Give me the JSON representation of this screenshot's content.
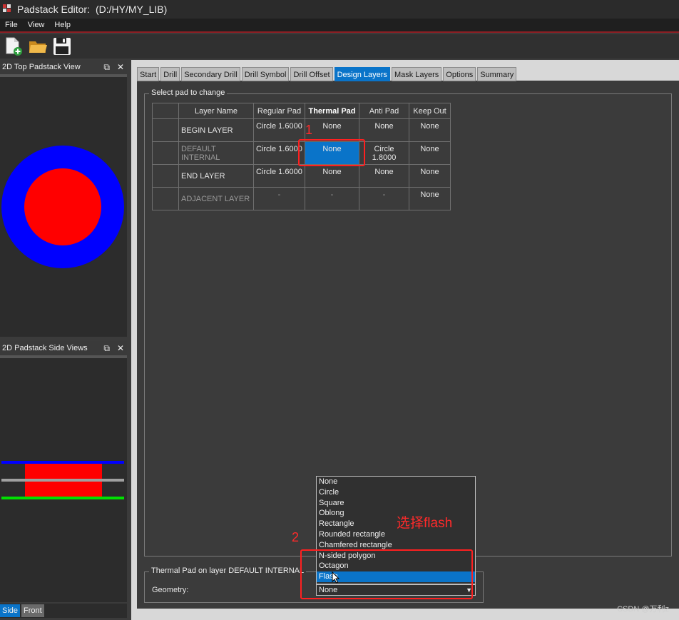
{
  "window": {
    "title": "Padstack Editor:",
    "path": "(D:/HY/MY_LIB)"
  },
  "menu": [
    "File",
    "View",
    "Help"
  ],
  "toolbar": {
    "icons": [
      "new-file-icon",
      "open-folder-icon",
      "save-icon"
    ]
  },
  "top_view": {
    "title": "2D Top Padstack View",
    "colors": {
      "outer": "#0000ff",
      "inner": "#ff0000"
    }
  },
  "side_view": {
    "title": "2D Padstack Side Views"
  },
  "bottom_tabs": [
    "Side",
    "Front"
  ],
  "tabs": [
    "Start",
    "Drill",
    "Secondary Drill",
    "Drill Symbol",
    "Drill Offset",
    "Design Layers",
    "Mask Layers",
    "Options",
    "Summary"
  ],
  "active_tab": "Design Layers",
  "pad_group": {
    "title": "Select pad to change"
  },
  "table": {
    "headers": [
      "",
      "Layer Name",
      "Regular Pad",
      "Thermal Pad",
      "Anti Pad",
      "Keep Out"
    ],
    "rows": [
      {
        "name": "BEGIN LAYER",
        "regular": "Circle 1.6000",
        "thermal": "None",
        "anti": "None",
        "keepout": "None"
      },
      {
        "name": "DEFAULT INTERNAL",
        "regular": "Circle 1.6000",
        "thermal": "None",
        "anti": "Circle 1.8000",
        "keepout": "None"
      },
      {
        "name": "END LAYER",
        "regular": "Circle 1.6000",
        "thermal": "None",
        "anti": "None",
        "keepout": "None"
      },
      {
        "name": "ADJACENT LAYER",
        "regular": "-",
        "thermal": "-",
        "anti": "-",
        "keepout": "None"
      }
    ]
  },
  "annotations": {
    "step1": "1",
    "step2": "2",
    "hint": "选择flash"
  },
  "geometry_group": {
    "title": "Thermal Pad on layer DEFAULT INTERNAL",
    "label": "Geometry:",
    "value": "None"
  },
  "dropdown_options": [
    "None",
    "Circle",
    "Square",
    "Oblong",
    "Rectangle",
    "Rounded rectangle",
    "Chamfered rectangle",
    "N-sided polygon",
    "Octagon",
    "Flash"
  ],
  "dropdown_selected": "Flash",
  "watermark": "CSDN @万利z"
}
